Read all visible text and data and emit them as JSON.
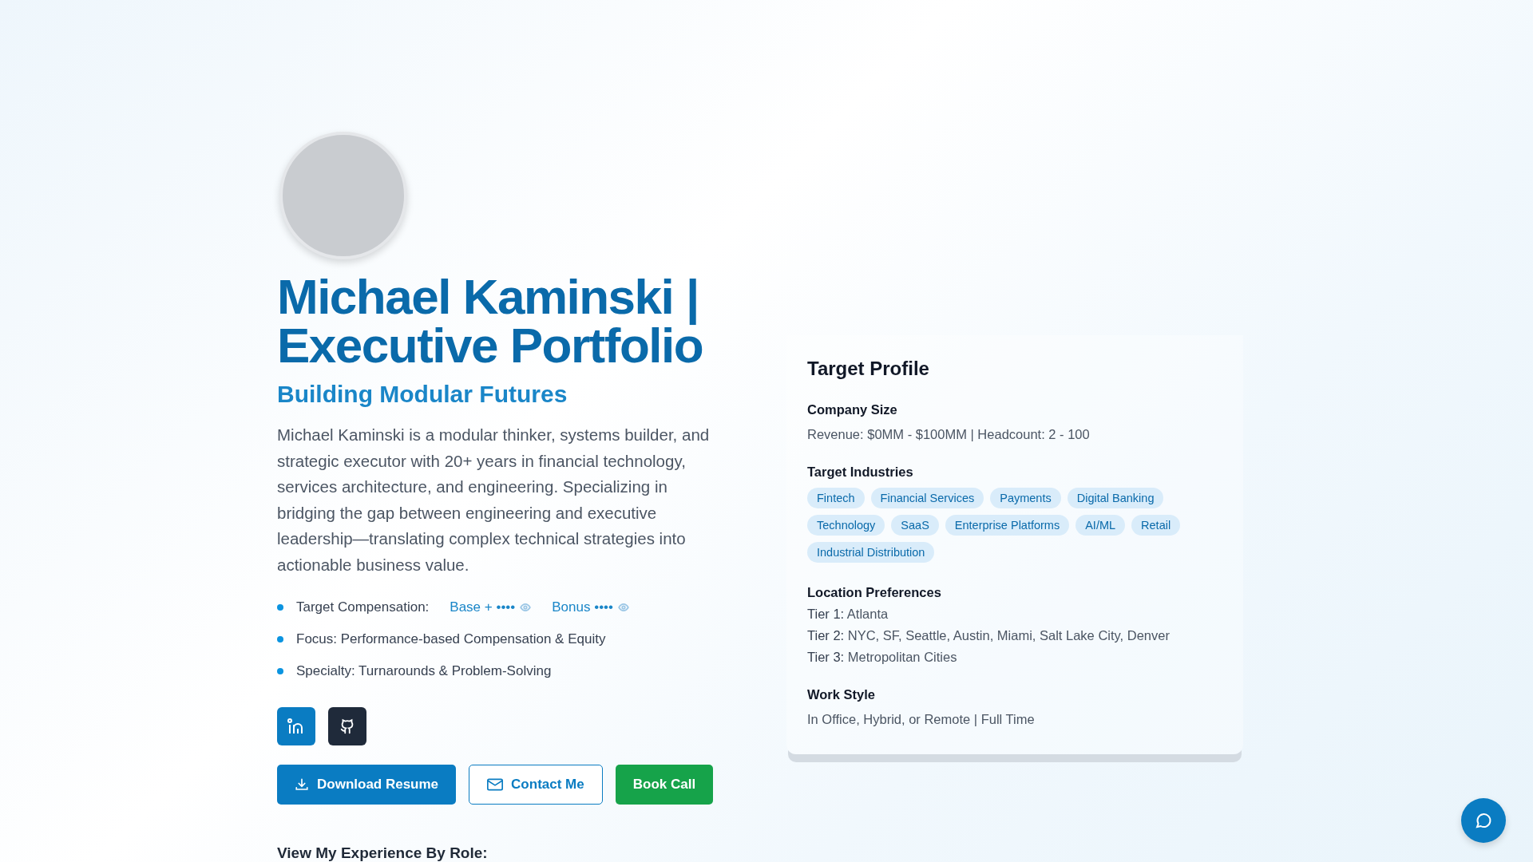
{
  "hero": {
    "title": "Michael Kaminski | Executive Portfolio",
    "subtitle": "Building Modular Futures",
    "bio": "Michael Kaminski is a modular thinker, systems builder, and strategic executor with 20+ years in financial technology, services architecture, and engineering. Specializing in bridging the gap between engineering and executive leadership—translating complex technical strategies into actionable business value.",
    "highlights": [
      {
        "kind": "compensation",
        "label": "Target Compensation:",
        "hidden_values": [
          "Base + ••••",
          "Bonus ••••"
        ]
      },
      {
        "kind": "text",
        "label": "Focus: Performance-based Compensation & Equity"
      },
      {
        "kind": "text",
        "label": "Specialty: Turnarounds & Problem-Solving"
      }
    ],
    "social": [
      {
        "kind": "linkedin"
      },
      {
        "kind": "github"
      }
    ],
    "buttons": [
      {
        "kind": "primary",
        "label": "Download Resume"
      },
      {
        "kind": "outline",
        "label": "Contact Me"
      },
      {
        "kind": "success",
        "label": "Book Call"
      }
    ],
    "section_heading": "View My Experience By Role:"
  },
  "target_profile": {
    "title": "Target Profile",
    "company_size": {
      "heading": "Company Size",
      "text": "Revenue: $0MM - $100MM | Headcount: 2 - 100"
    },
    "industries": {
      "heading": "Target Industries",
      "tags": [
        "Fintech",
        "Financial Services",
        "Payments",
        "Digital Banking",
        "Technology",
        "SaaS",
        "Enterprise Platforms",
        "AI/ML",
        "Retail",
        "Industrial Distribution"
      ]
    },
    "locations": {
      "heading": "Location Preferences",
      "tiers": [
        {
          "label": "Tier 1:",
          "value": "Atlanta"
        },
        {
          "label": "Tier 2:",
          "value": "NYC, SF, Seattle, Austin, Miami, Salt Lake City, Denver"
        },
        {
          "label": "Tier 3:",
          "value": "Metropolitan Cities"
        }
      ]
    },
    "work_style": {
      "heading": "Work Style",
      "text": "In Office, Hybrid, or Remote | Full Time"
    }
  }
}
